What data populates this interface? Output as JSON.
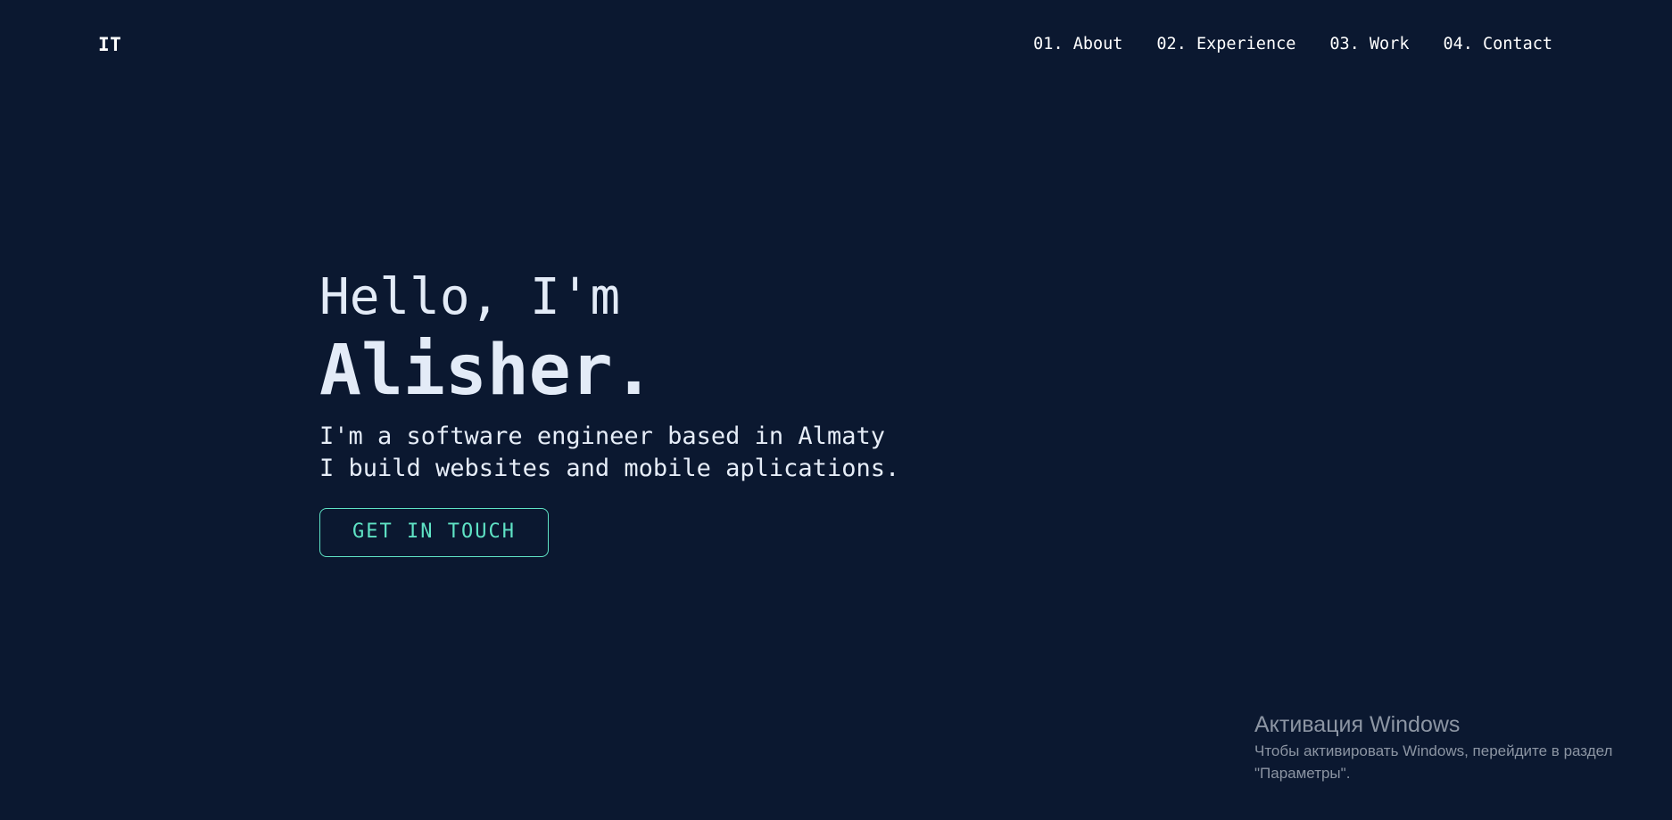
{
  "header": {
    "logo": "IT",
    "nav": [
      {
        "label": "01. About"
      },
      {
        "label": "02. Experience"
      },
      {
        "label": "03. Work"
      },
      {
        "label": "04. Contact"
      }
    ]
  },
  "hero": {
    "greeting": "Hello, I'm",
    "name": "Alisher.",
    "description_line1": "I'm a software engineer based in Almaty",
    "description_line2": "I build websites and mobile aplications.",
    "cta_label": "GET IN TOUCH"
  },
  "windows_activation": {
    "title": "Активация Windows",
    "line1": "Чтобы активировать Windows, перейдите в раздел",
    "line2": "\"Параметры\"."
  },
  "colors": {
    "background": "#0b1830",
    "text": "#e6edf8",
    "accent": "#5fe3c5",
    "watermark": "#8c95a3"
  }
}
